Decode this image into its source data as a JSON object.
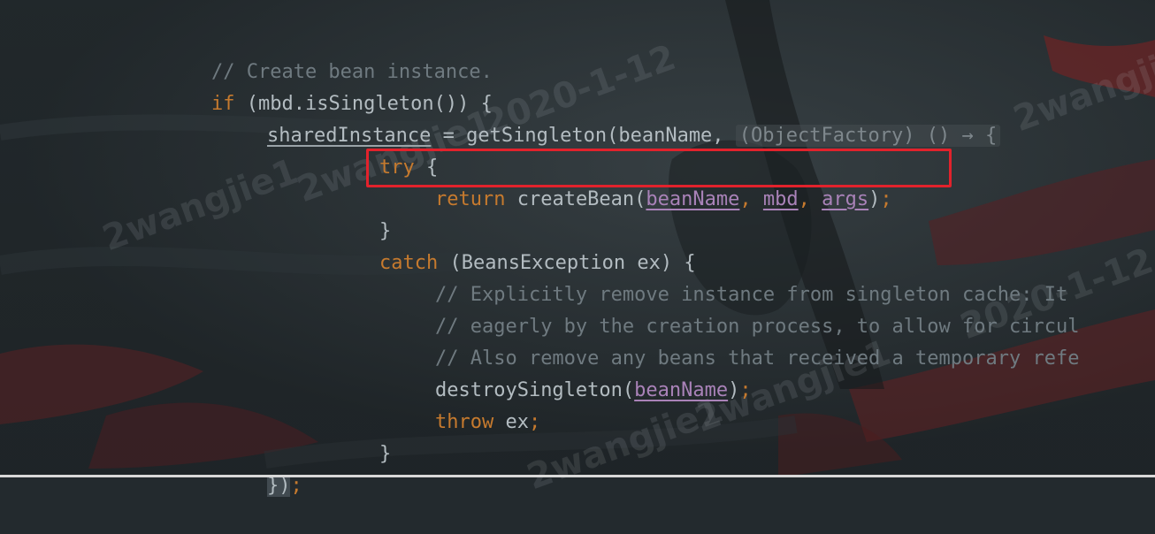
{
  "code": {
    "line1": {
      "comment": "// Create bean instance."
    },
    "line2": {
      "kw_if": "if",
      "rest": " (mbd.isSingleton()) {"
    },
    "line3": {
      "var": "sharedInstance",
      "mid": " = getSingleton(beanName, ",
      "hint": "(ObjectFactory) () → {"
    },
    "line4": {
      "kw_try": "try",
      "rest": " {"
    },
    "line5": {
      "kw_return": "return",
      "call": " createBean(",
      "p1": "beanName",
      "sep1": ", ",
      "p2": "mbd",
      "sep2": ", ",
      "p3": "args",
      "close": ")",
      "semi": ";"
    },
    "line6": {
      "text": "}"
    },
    "line7": {
      "kw_catch": "catch",
      "rest": " (BeansException ex) {"
    },
    "line8": {
      "comment": "// Explicitly remove instance from singleton cache: It"
    },
    "line9": {
      "comment": "// eagerly by the creation process, to allow for circul"
    },
    "line10": {
      "comment": "// Also remove any beans that received a temporary refe"
    },
    "line11": {
      "call": "destroySingleton(",
      "p1": "beanName",
      "close": ")",
      "semi": ";"
    },
    "line12": {
      "kw_throw": "throw",
      "rest": " ex",
      "semi": ";"
    },
    "line13": {
      "text": "}"
    },
    "line14": {
      "brace": "})",
      "semi": ";"
    }
  },
  "watermarks": [
    "2wangjie1",
    "2020-1-12",
    "2wangjie1",
    "2wangjie1",
    "2020-1-12",
    "2wangjie1",
    "2wangjie1"
  ],
  "colors": {
    "keyword": "#c67a2e",
    "comment": "#6f7a80",
    "identifier": "#b3bcc1",
    "parameter": "#a982b8",
    "highlight_border": "#e2222c",
    "background": "#232a2e"
  }
}
